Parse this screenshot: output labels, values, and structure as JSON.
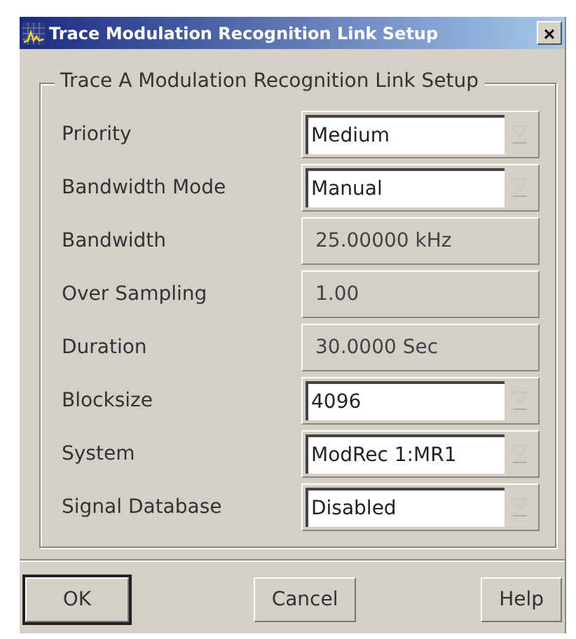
{
  "window": {
    "title": "Trace Modulation Recognition Link Setup",
    "close": "×"
  },
  "group": {
    "title": "Trace A Modulation Recognition Link Setup",
    "rows": [
      {
        "label": "Priority",
        "kind": "dropdown",
        "value": "Medium"
      },
      {
        "label": "Bandwidth Mode",
        "kind": "dropdown",
        "value": "Manual"
      },
      {
        "label": "Bandwidth",
        "kind": "readout",
        "value": "25.00000 kHz"
      },
      {
        "label": "Over Sampling",
        "kind": "readout",
        "value": "1.00"
      },
      {
        "label": "Duration",
        "kind": "readout",
        "value": "30.0000 Sec"
      },
      {
        "label": "Blocksize",
        "kind": "dropdown",
        "value": "4096"
      },
      {
        "label": "System",
        "kind": "dropdown",
        "value": "ModRec 1:MR1"
      },
      {
        "label": "Signal Database",
        "kind": "dropdown",
        "value": "Disabled"
      }
    ]
  },
  "buttons": [
    {
      "label": "OK",
      "default": true
    },
    {
      "label": "Cancel",
      "default": false
    },
    {
      "label": "Help",
      "default": false
    }
  ]
}
